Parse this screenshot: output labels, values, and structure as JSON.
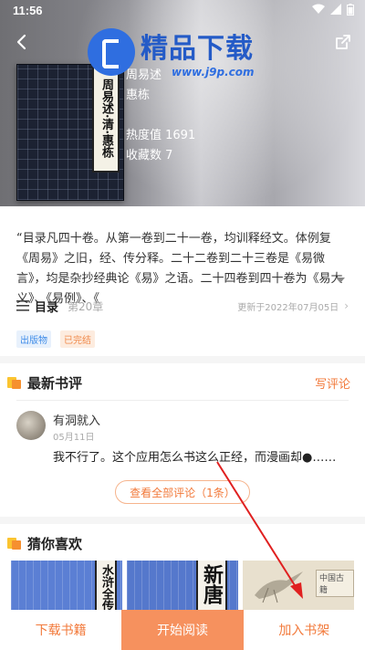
{
  "status_bar": {
    "time": "11:56"
  },
  "watermark": {
    "title": "精品下载",
    "url": "www.j9p.com"
  },
  "book": {
    "cover_title": "周易述·清·惠栋",
    "title": "周易述",
    "author": "惠栋",
    "popularity": "热度值 1691",
    "favorites": "收藏数 7",
    "description": "“目录凡四十卷。从第一卷到二十一卷，均训释经文。体例复《周易》之旧，经、传分释。二十二卷到二十三卷是《易微言》，均是杂抄经典论《易》之语。二十四卷到四十卷为《易大义》、《易例》、《"
  },
  "toc": {
    "label": "目录",
    "chapter": "第20章",
    "updated": "更新于2022年07月05日"
  },
  "tags": [
    "出版物",
    "已完结"
  ],
  "reviews": {
    "title": "最新书评",
    "write_label": "写评论",
    "items": [
      {
        "user": "有洞就入",
        "date": "05月11日",
        "text": "我不行了。这个应用怎么书这么正经，而漫画却●……"
      }
    ],
    "all_label": "查看全部评论（1条）"
  },
  "recommend": {
    "title": "猜你喜欢",
    "books": [
      {
        "spine": "水浒全传"
      },
      {
        "spine": "新唐"
      },
      {
        "spine": "中国古籍"
      }
    ]
  },
  "bottom_bar": {
    "download": "下载书籍",
    "read": "开始阅读",
    "shelf": "加入书架"
  },
  "colors": {
    "accent": "#f2793a",
    "read_button": "#f6915e",
    "tag_blue": "#3f8ce8",
    "annotation_arrow": "#e02020"
  }
}
